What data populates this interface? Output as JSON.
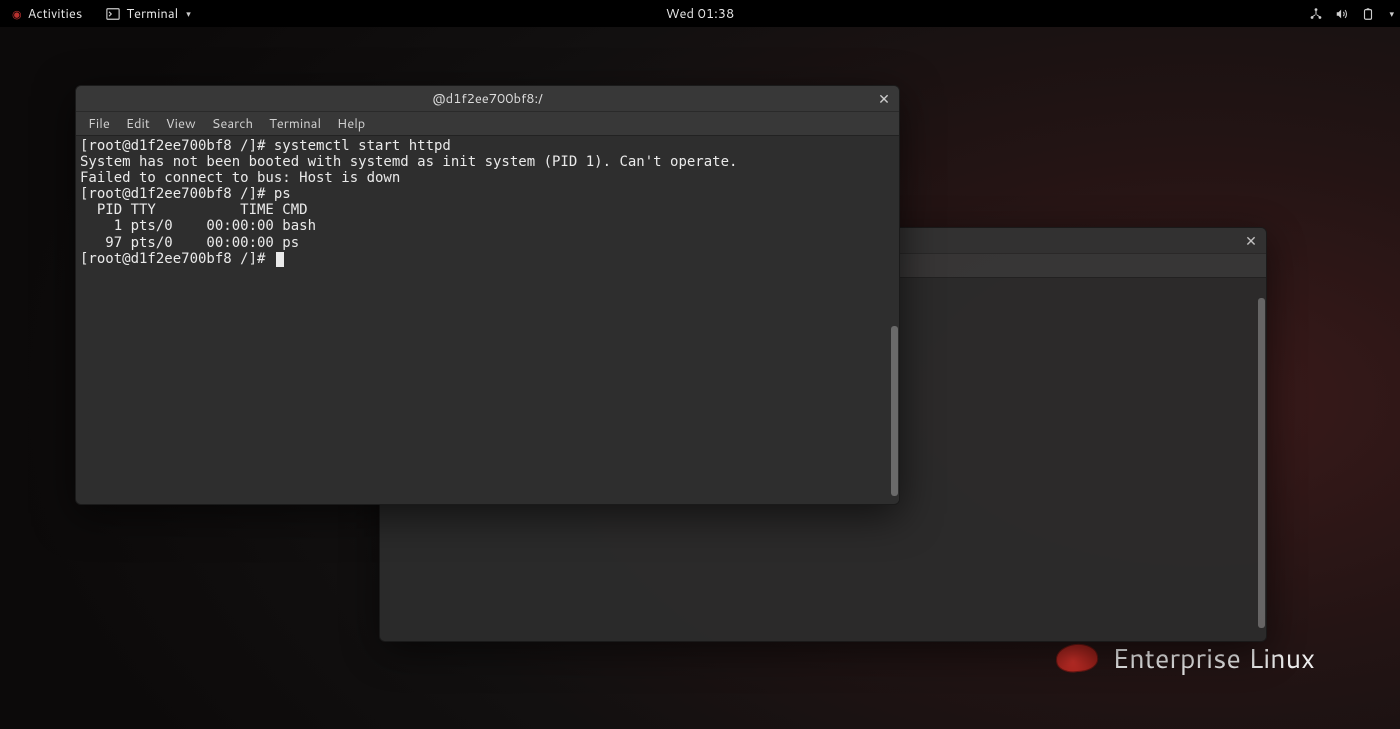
{
  "topbar": {
    "activities": "Activities",
    "app_label": "Terminal",
    "clock": "Wed 01:38"
  },
  "branding": {
    "text": "Enterprise Linux"
  },
  "bg_window": {
    "title": "",
    "close_tooltip": "Close"
  },
  "fg_window": {
    "title": "@d1f2ee700bf8:/",
    "close_tooltip": "Close",
    "menus": [
      "File",
      "Edit",
      "View",
      "Search",
      "Terminal",
      "Help"
    ],
    "lines": [
      "[root@d1f2ee700bf8 /]# systemctl start httpd",
      "System has not been booted with systemd as init system (PID 1). Can't operate.",
      "Failed to connect to bus: Host is down",
      "[root@d1f2ee700bf8 /]# ps",
      "  PID TTY          TIME CMD",
      "    1 pts/0    00:00:00 bash",
      "   97 pts/0    00:00:00 ps",
      "[root@d1f2ee700bf8 /]# "
    ]
  }
}
